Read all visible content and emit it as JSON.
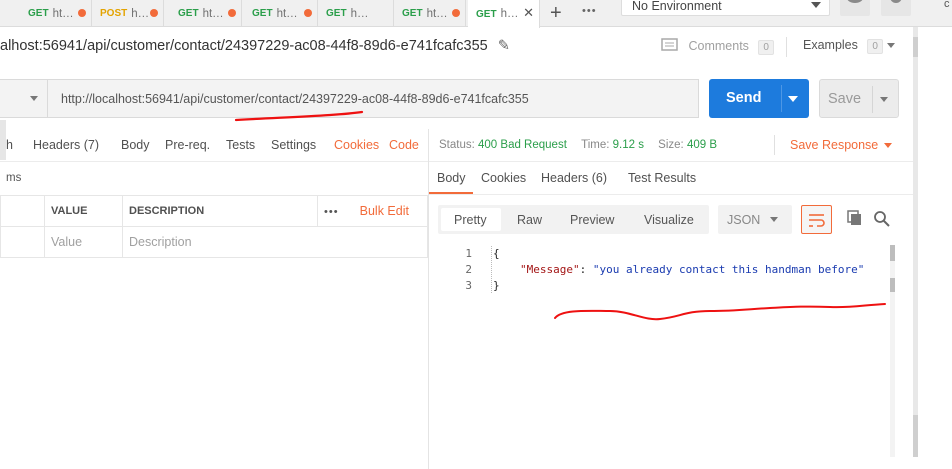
{
  "tabs": [
    {
      "method": "GET",
      "label": "ht",
      "dirty": true
    },
    {
      "method": "POST",
      "label": "h",
      "dirty": true
    },
    {
      "method": "GET",
      "label": "ht",
      "dirty": true
    },
    {
      "method": "GET",
      "label": "ht",
      "dirty": true
    },
    {
      "method": "GET",
      "label": "h",
      "dirty": false
    },
    {
      "method": "GET",
      "label": "ht",
      "dirty": true
    },
    {
      "method": "GET",
      "label": "h",
      "active": true
    }
  ],
  "environment": {
    "selected": "No Environment"
  },
  "request": {
    "path_title": "alhost:56941/api/customer/contact/24397229-ac08-44f8-89d6-e741fcafc355",
    "comments_label": "Comments",
    "comments_count": "0",
    "examples_label": "Examples",
    "examples_count": "0",
    "url": "http://localhost:56941/api/customer/contact/24397229-ac08-44f8-89d6-e741fcafc355",
    "send_label": "Send",
    "save_label": "Save"
  },
  "request_tabs": {
    "auth_fragment": "h",
    "headers": "Headers",
    "headers_count": "(7)",
    "body": "Body",
    "prereq": "Pre-req.",
    "tests": "Tests",
    "settings": "Settings",
    "cookies": "Cookies",
    "code": "Code"
  },
  "params": {
    "section_fragment": "ms",
    "col_value": "VALUE",
    "col_description": "DESCRIPTION",
    "bulk_edit": "Bulk Edit",
    "more": "•••",
    "value_placeholder": "Value",
    "description_placeholder": "Description"
  },
  "response": {
    "status_label": "Status:",
    "status_value": "400 Bad Request",
    "time_label": "Time:",
    "time_value": "9.12 s",
    "size_label": "Size:",
    "size_value": "409 B",
    "save_response": "Save Response",
    "tabs": {
      "body": "Body",
      "cookies": "Cookies",
      "headers": "Headers",
      "headers_count": "(6)",
      "tests": "Test Results"
    },
    "views": [
      "Pretty",
      "Raw",
      "Preview",
      "Visualize"
    ],
    "format": "JSON",
    "lines": [
      "1",
      "2",
      "3"
    ],
    "code": {
      "open": "{",
      "key": "\"Message\"",
      "colon": ": ",
      "value": "\"you already contact this handman before\"",
      "close": "}"
    }
  },
  "colors": {
    "accent": "#f26b3a",
    "send": "#1d7bdd",
    "success": "#2a9e4a"
  }
}
